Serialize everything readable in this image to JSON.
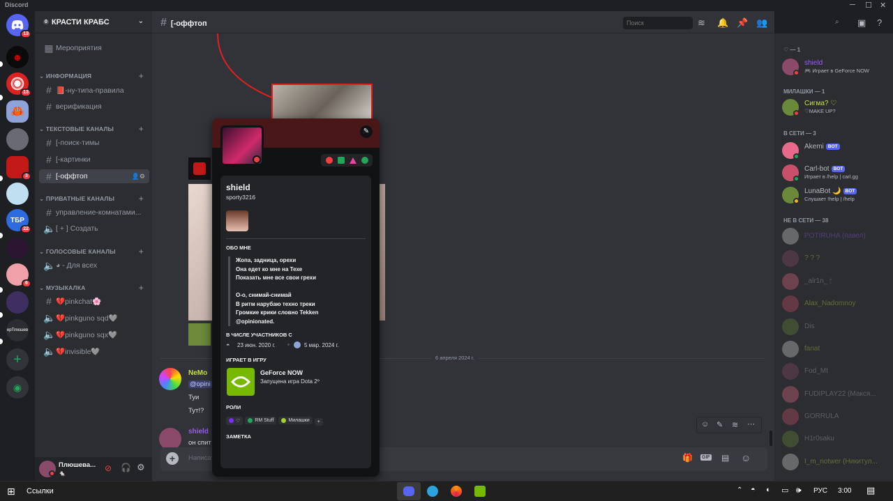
{
  "window": {
    "app_name": "Discord"
  },
  "servers": [
    {
      "badge": "13"
    },
    {
      "badge": ""
    },
    {
      "badge": "13"
    },
    {
      "badge": ""
    },
    {
      "badge": ""
    },
    {
      "badge": "3"
    },
    {
      "badge": ""
    },
    {
      "badge": "22",
      "label": "ТБР"
    },
    {
      "badge": ""
    },
    {
      "badge": "6"
    },
    {
      "badge": ""
    },
    {
      "badge": "",
      "label": "ерПлюшев"
    }
  ],
  "server": {
    "name": "КРАСТИ КРАБС",
    "boost_count": "0"
  },
  "channels": {
    "events": "Мероприятия",
    "categories": [
      {
        "name": "ИНФОРМАЦИЯ",
        "items": [
          "📕-ну-типа-правила",
          "верификация"
        ]
      },
      {
        "name": "ТЕКСТОВЫЕ КАНАЛЫ",
        "items": [
          "[-поиск-тимы",
          "[-картинки",
          "[-оффтоп"
        ]
      },
      {
        "name": "ПРИВАТНЫЕ КАНАЛЫ",
        "items": [
          "управление-комнатами...",
          "[ + ] Создать"
        ]
      },
      {
        "name": "ГОЛОСОВЫЕ КАНАЛЫ",
        "items": [
          "◕ - Для всех"
        ]
      },
      {
        "name": "МУЗЫКАЛКА",
        "items": [
          "💔pinkchat🌸",
          "💔pinkguno sqd🩶",
          "💔pinkguno sqx🩶",
          "💔invisible🩶"
        ]
      }
    ]
  },
  "user_panel": {
    "name": "Плюшева...",
    "status": "🐁"
  },
  "channel_header": {
    "name": "[-оффтоп",
    "search_placeholder": "Поиск"
  },
  "chat": {
    "date_divider": "6 апреля 2024 г.",
    "messages": [
      {
        "author": "NeMo",
        "lines": [
          "@opini",
          "Туи",
          "Тут!?"
        ]
      },
      {
        "author": "shield",
        "lines": [
          "он спит"
        ]
      }
    ],
    "composer_placeholder": "Написать"
  },
  "profile": {
    "display_name": "shield",
    "username": "sporty3216",
    "about_title": "ОБО МНЕ",
    "bio": [
      "Жопа, задница, орехи",
      "Она едет ко мне на Техе",
      "Показать мне все свои грехи",
      "",
      "О-о, снимай-снимай",
      "В ритм нарубаю техно треки",
      "Громкие крики словно Tekken",
      "@opinionated."
    ],
    "member_since_title": "В ЧИСЛЕ УЧАСТНИКОВ С",
    "discord_since": "23 июн. 2020 г.",
    "server_since": "5 мар. 2024 г.",
    "activity_title": "ИГРАЕТ В ИГРУ",
    "activity_name": "GeForce NOW",
    "activity_detail": "Запущена игра Dota 2º",
    "roles_title": "РОЛИ",
    "roles": [
      {
        "name": "♡",
        "color": "#7b2cff"
      },
      {
        "name": "RM Stuff",
        "color": "#23a55a"
      },
      {
        "name": "Милашки",
        "color": "#a3d12f"
      }
    ],
    "note_title": "ЗАМЕТКА"
  },
  "members": {
    "groups": [
      {
        "header": "♡ — 1",
        "items": [
          {
            "name": "shield",
            "color": "#9b59ff",
            "sub": "🎮 Играет в GeForce NOW",
            "status": "#f23f43"
          }
        ]
      },
      {
        "header": "МИЛАШКИ — 1",
        "items": [
          {
            "name": "Сигма? ♡",
            "color": "#c4e04a",
            "sub": "♡MAKE UP?",
            "status": "#f23f43"
          }
        ]
      },
      {
        "header": "В СЕТИ — 3",
        "items": [
          {
            "name": "Akemi",
            "color": "#b5bac1",
            "sub": "",
            "status": "#23a55a",
            "bot": "BOT"
          },
          {
            "name": "Carl-bot",
            "color": "#b5bac1",
            "sub": "Играет в /help | carl.gg",
            "status": "#23a55a",
            "bot": "BOT"
          },
          {
            "name": "LunaBot 🌙",
            "color": "#b5bac1",
            "sub": "Слушает !help | /help",
            "status": "#f0b232",
            "bot": "BOT"
          }
        ]
      },
      {
        "header": "НЕ В СЕТИ — 38",
        "items": [
          {
            "name": "POTIRUHA (павел)",
            "color": "#9b59ff"
          },
          {
            "name": "? ? ?",
            "color": "#c4e04a"
          },
          {
            "name": "_alr1n_ 🕯",
            "color": "#b5bac1"
          },
          {
            "name": "Alax_Nadomnoy",
            "color": "#c4e04a"
          },
          {
            "name": "Dis",
            "color": "#b5bac1"
          },
          {
            "name": "fanat",
            "color": "#c4e04a"
          },
          {
            "name": "Fod_Mt",
            "color": "#b5bac1"
          },
          {
            "name": "FUDIPLAY22 (Макся...",
            "color": "#b5bac1"
          },
          {
            "name": "GORRULA",
            "color": "#b5bac1"
          },
          {
            "name": "H1r0saku",
            "color": "#b5bac1"
          },
          {
            "name": "I_m_notwer (Никитул...",
            "color": "#c4e04a"
          }
        ]
      }
    ]
  },
  "taskbar": {
    "search_label": "Ссылки",
    "language": "РУС",
    "time": "3:00"
  }
}
